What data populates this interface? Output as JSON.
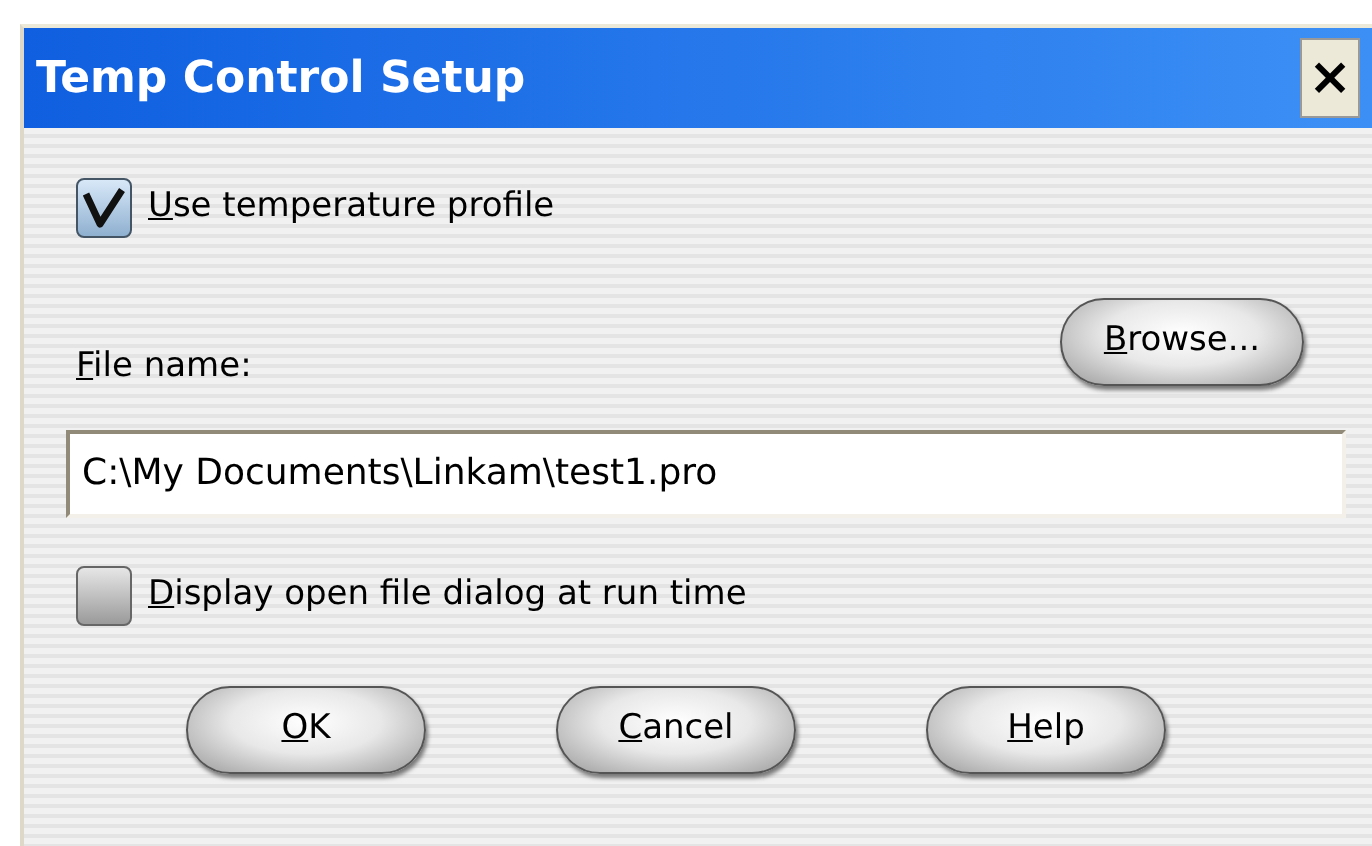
{
  "window": {
    "title": "Temp Control Setup",
    "close": "×"
  },
  "use_profile": {
    "label": "Use temperature profile",
    "checked": true
  },
  "file": {
    "label": "File name:",
    "browse": "Browse...",
    "value": "C:\\My Documents\\Linkam\\test1.pro"
  },
  "display_dialog": {
    "label": "Display open file dialog at run time",
    "checked": false
  },
  "buttons": [
    {
      "label": "OK"
    },
    {
      "label": "Cancel"
    },
    {
      "label": "Help"
    }
  ]
}
